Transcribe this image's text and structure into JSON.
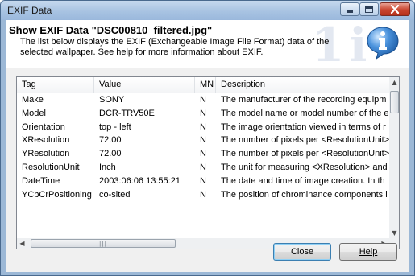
{
  "window": {
    "title": "EXIF Data"
  },
  "banner": {
    "title": "Show EXIF Data \"DSC00810_filtered.jpg\"",
    "description": "The list below displays the EXIF (Exchangeable Image File Format) data of the selected wallpaper. See help for more information about EXIF."
  },
  "list": {
    "columns": [
      "Tag",
      "Value",
      "MN",
      "Description"
    ],
    "rows": [
      {
        "tag": "Make",
        "value": "SONY",
        "mn": "N",
        "description": "The manufacturer of the recording equipm"
      },
      {
        "tag": "Model",
        "value": "DCR-TRV50E",
        "mn": "N",
        "description": "The model name or model number of the e"
      },
      {
        "tag": "Orientation",
        "value": "top - left",
        "mn": "N",
        "description": "The image orientation viewed in terms of r"
      },
      {
        "tag": "XResolution",
        "value": "72.00",
        "mn": "N",
        "description": "The number of pixels per <ResolutionUnit>"
      },
      {
        "tag": "YResolution",
        "value": "72.00",
        "mn": "N",
        "description": "The number of pixels per <ResolutionUnit>"
      },
      {
        "tag": "ResolutionUnit",
        "value": "Inch",
        "mn": "N",
        "description": "The unit for measuring <XResolution> and"
      },
      {
        "tag": "DateTime",
        "value": "2003:06:06 13:55:21",
        "mn": "N",
        "description": "The date and time of image creation. In th"
      },
      {
        "tag": "YCbCrPositioning",
        "value": "co-sited",
        "mn": "N",
        "description": "The position of chrominance components i"
      }
    ]
  },
  "buttons": {
    "close": "Close",
    "help": "Help"
  },
  "icons": {
    "info": "info-icon",
    "minimize": "minimize-icon",
    "maximize": "maximize-icon",
    "close": "close-icon"
  },
  "colors": {
    "titlebar": "#a8c3e2",
    "close_button": "#c9452f",
    "info_icon": "#2a6fb8"
  }
}
